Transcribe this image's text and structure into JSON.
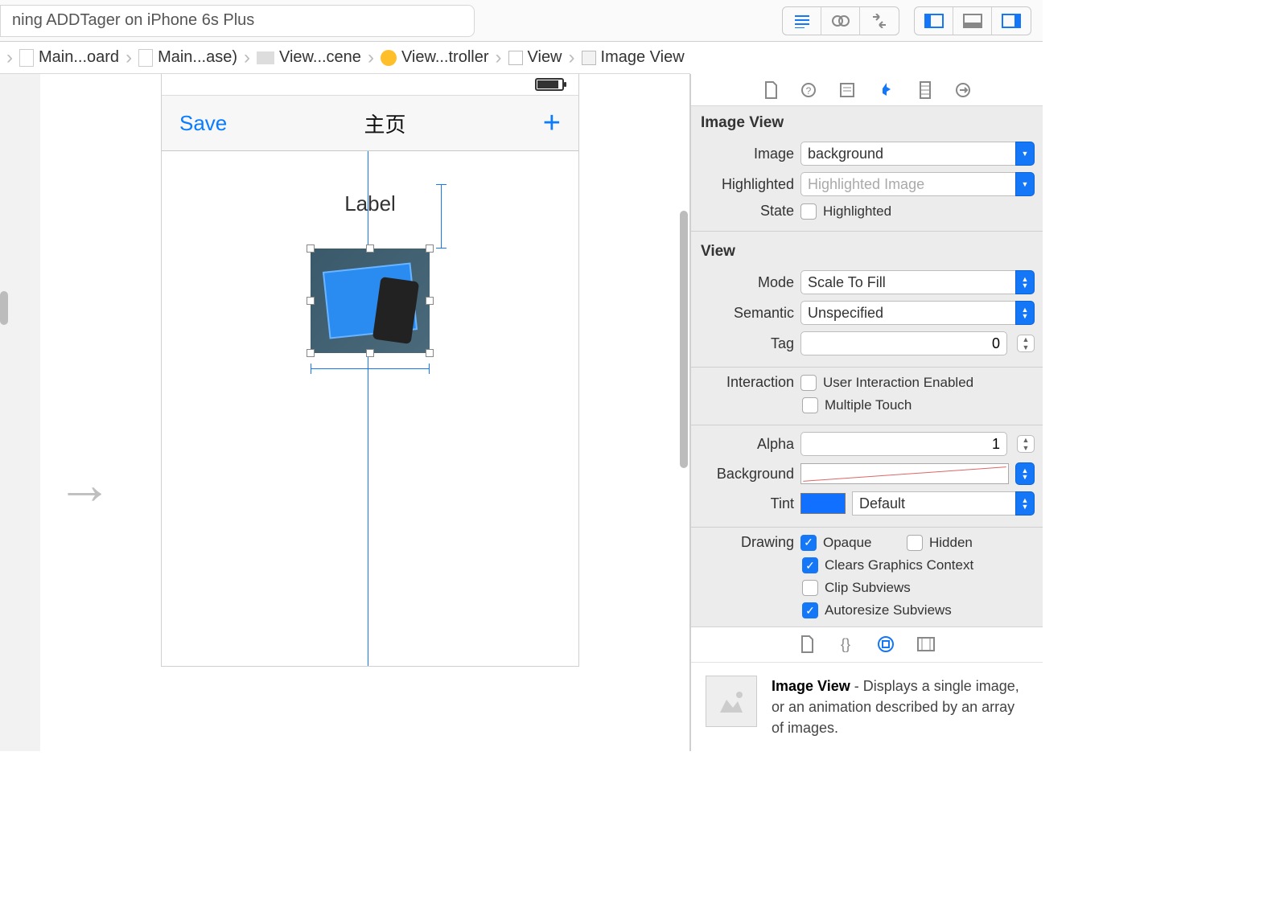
{
  "toolbar": {
    "status_text": "ning ADDTager on iPhone 6s Plus"
  },
  "breadcrumb": {
    "items": [
      {
        "label": "Main...oard"
      },
      {
        "label": "Main...ase)"
      },
      {
        "label": "View...cene"
      },
      {
        "label": "View...troller"
      },
      {
        "label": "View"
      },
      {
        "label": "Image View"
      }
    ]
  },
  "canvas": {
    "nav_left": "Save",
    "nav_title": "主页",
    "nav_plus": "+",
    "label_text": "Label"
  },
  "inspector": {
    "section_imageview": "Image View",
    "image_label": "Image",
    "image_value": "background",
    "highlighted_label": "Highlighted",
    "highlighted_placeholder": "Highlighted Image",
    "state_label": "State",
    "state_check_label": "Highlighted",
    "section_view": "View",
    "mode_label": "Mode",
    "mode_value": "Scale To Fill",
    "semantic_label": "Semantic",
    "semantic_value": "Unspecified",
    "tag_label": "Tag",
    "tag_value": "0",
    "interaction_label": "Interaction",
    "uie_label": "User Interaction Enabled",
    "mt_label": "Multiple Touch",
    "alpha_label": "Alpha",
    "alpha_value": "1",
    "background_label": "Background",
    "tint_label": "Tint",
    "tint_value": "Default",
    "drawing_label": "Drawing",
    "opaque_label": "Opaque",
    "hidden_label": "Hidden",
    "cgc_label": "Clears Graphics Context",
    "clip_label": "Clip Subviews",
    "auto_label": "Autoresize Subviews"
  },
  "library": {
    "item_title": "Image View",
    "item_desc": " - Displays a single image, or an animation described by an array of images."
  }
}
